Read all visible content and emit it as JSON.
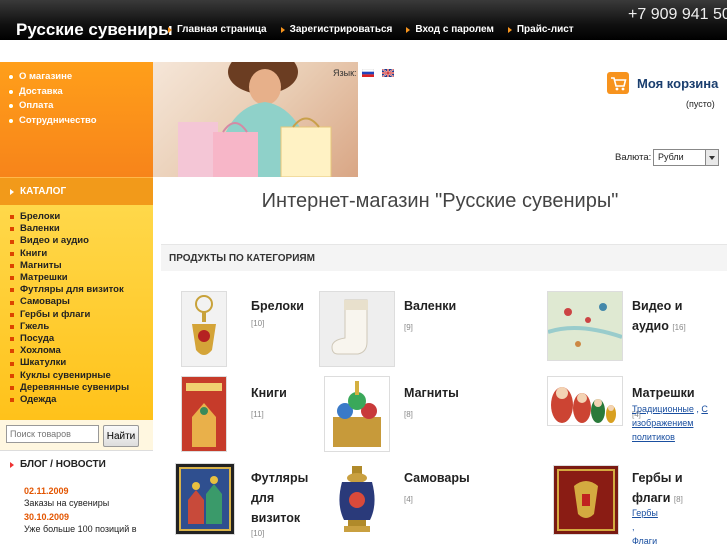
{
  "header": {
    "site_title": "Русские сувениры",
    "phone": "+7 909 941 50",
    "nav": [
      {
        "label": "Главная страница"
      },
      {
        "label": "Зарегистрироваться"
      },
      {
        "label": "Вход с паролем"
      },
      {
        "label": "Прайс-лист"
      }
    ]
  },
  "info_menu": [
    {
      "label": "О магазине"
    },
    {
      "label": "Доставка"
    },
    {
      "label": "Оплата"
    },
    {
      "label": "Сотрудничество"
    }
  ],
  "catalog": {
    "heading": "КАТАЛОГ",
    "items": [
      {
        "label": "Брелоки"
      },
      {
        "label": "Валенки"
      },
      {
        "label": "Видео и аудио"
      },
      {
        "label": "Книги"
      },
      {
        "label": "Магниты"
      },
      {
        "label": "Матрешки"
      },
      {
        "label": "Футляры для визиток"
      },
      {
        "label": "Самовары"
      },
      {
        "label": "Гербы и флаги"
      },
      {
        "label": "Гжель"
      },
      {
        "label": "Посуда"
      },
      {
        "label": "Хохлома"
      },
      {
        "label": "Шкатулки"
      },
      {
        "label": "Куклы сувенирные"
      },
      {
        "label": "Деревянные сувениры"
      },
      {
        "label": "Одежда"
      }
    ]
  },
  "search": {
    "placeholder": "Поиск товаров",
    "button": "Найти"
  },
  "blog": {
    "heading": "БЛОГ / НОВОСТИ",
    "posts": [
      {
        "date": "02.11.2009",
        "title": "Заказы на сувениры"
      },
      {
        "date": "30.10.2009",
        "title": "Уже больше 100 позиций в"
      }
    ]
  },
  "language": {
    "label": "Язык:"
  },
  "cart": {
    "title": "Моя корзина",
    "status": "(пусто)"
  },
  "currency": {
    "label": "Валюта:",
    "selected": "Рубли"
  },
  "main": {
    "title": "Интернет-магазин \"Русские сувениры\"",
    "section": "ПРОДУКТЫ ПО КАТЕГОРИЯМ"
  },
  "products": [
    {
      "name": "Брелоки",
      "count": "[10]",
      "icon": "keychain"
    },
    {
      "name": "Валенки",
      "count": "[9]",
      "icon": "felt-boot"
    },
    {
      "name": "Видео и аудио",
      "count": "[16]",
      "icon": "map"
    },
    {
      "name": "Книги",
      "count": "[11]",
      "icon": "book"
    },
    {
      "name": "Магниты",
      "count": "[8]",
      "icon": "magnet"
    },
    {
      "name": "Матрешки",
      "count": "[4]",
      "icon": "matryoshka",
      "subs": [
        "Традиционные",
        "С изображением политиков"
      ]
    },
    {
      "name": "Футляры для визиток",
      "count": "[10]",
      "icon": "card-case"
    },
    {
      "name": "Самовары",
      "count": "[4]",
      "icon": "samovar"
    },
    {
      "name": "Гербы и флаги",
      "count": "[8]",
      "icon": "coat-of-arms",
      "subs": [
        "Гербы",
        "Флаги"
      ]
    }
  ],
  "colors": {
    "accent_orange": "#f7941d",
    "catalog_yellow": "#ffcc22",
    "cart_blue": "#1a3e6e",
    "link_blue": "#1a4fa0",
    "date_orange": "#e35500"
  }
}
